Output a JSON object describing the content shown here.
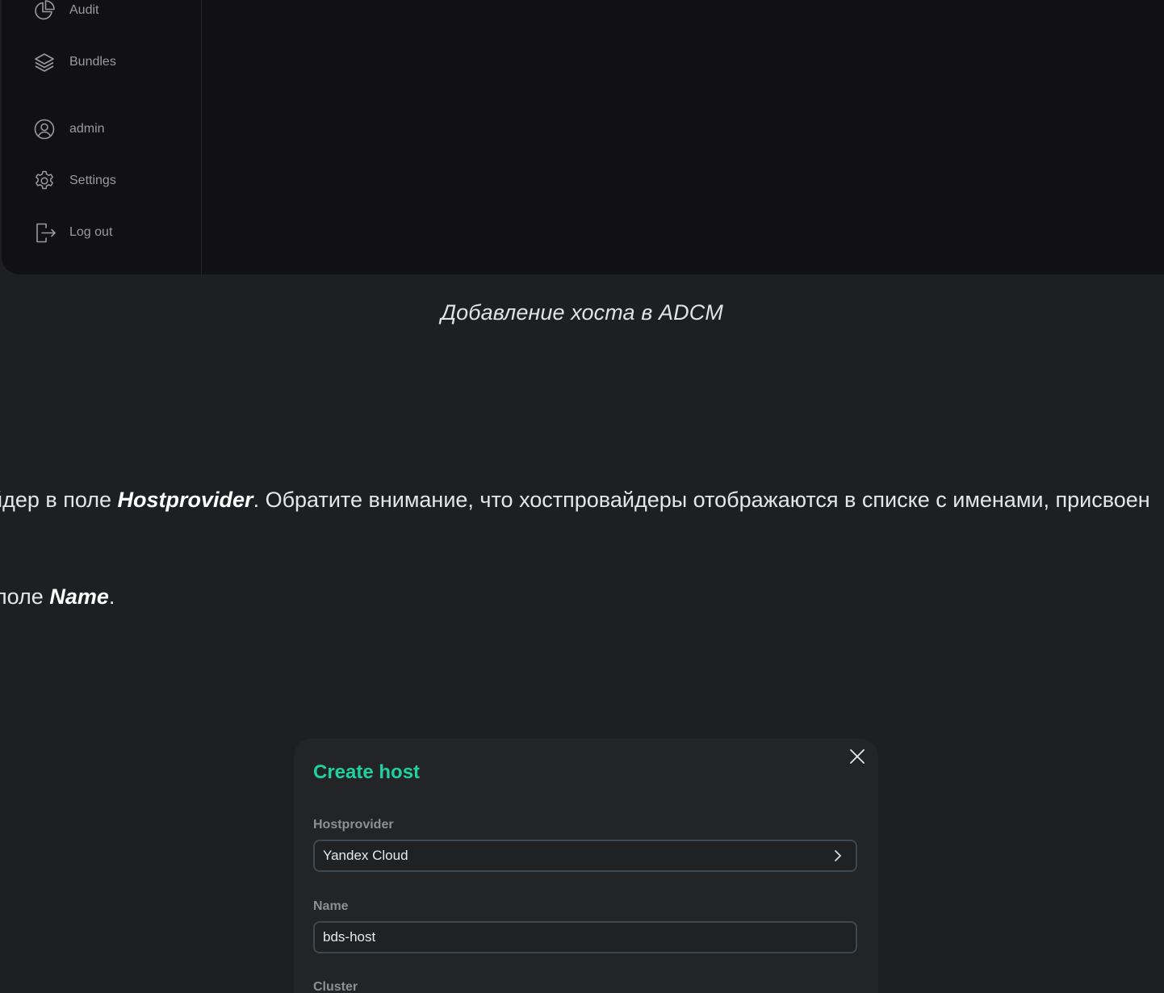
{
  "sidebar": {
    "items": [
      {
        "label": "Audit",
        "icon": "pie-chart-icon"
      },
      {
        "label": "Bundles",
        "icon": "layers-icon"
      },
      {
        "label": "admin",
        "icon": "user-icon"
      },
      {
        "label": "Settings",
        "icon": "gear-icon"
      },
      {
        "label": "Log out",
        "icon": "logout-icon"
      }
    ]
  },
  "caption": "Добавление хоста в ADCM",
  "para1": {
    "pre": "йдер в поле ",
    "bold": "Hostprovider",
    "post": ". Обратите внимание, что хостпровайдеры отображаются в списке с именами, присвоен"
  },
  "para2": {
    "pre": "поле ",
    "bold": "Name",
    "post": "."
  },
  "modal": {
    "title": "Create host",
    "fields": [
      {
        "label": "Hostprovider",
        "value": "Yandex Cloud"
      },
      {
        "label": "Name",
        "value": "bds-host"
      },
      {
        "label": "Cluster"
      }
    ]
  },
  "colors": {
    "accent": "#1fd1a1",
    "page_bg": "#1e1f21",
    "panel_bg": "#111014"
  }
}
